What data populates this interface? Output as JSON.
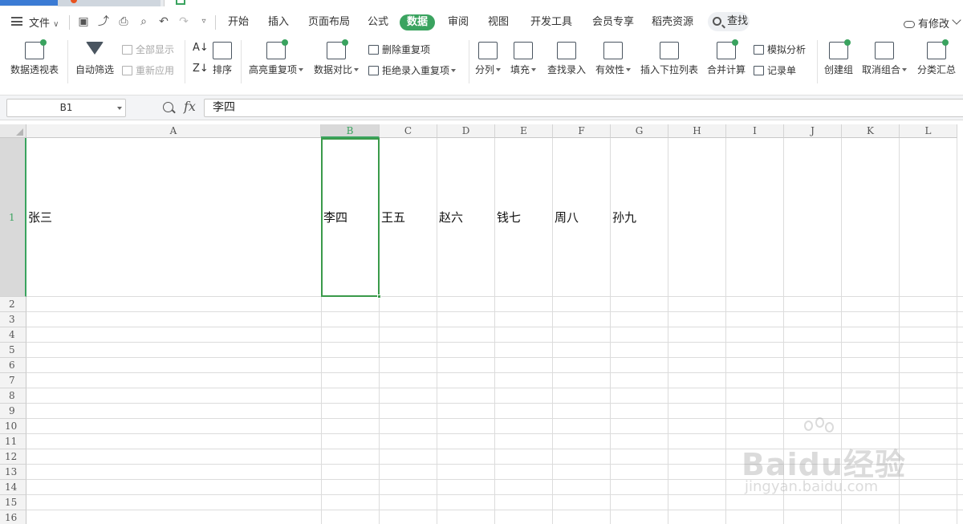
{
  "menu": {
    "file": "文件",
    "tabs": [
      "开始",
      "插入",
      "页面布局",
      "公式",
      "数据",
      "审阅",
      "视图",
      "开发工具",
      "会员专享",
      "稻壳资源"
    ],
    "active_tab": "数据",
    "search": "查找",
    "status": "有修改"
  },
  "ribbon": {
    "pivot": "数据透视表",
    "autofilter": "自动筛选",
    "show_all": "全部显示",
    "reapply": "重新应用",
    "sort": "排序",
    "highlight_dup": "高亮重复项",
    "compare": "数据对比",
    "delete_dup": "删除重复项",
    "reject_dup": "拒绝录入重复项",
    "split": "分列",
    "fill": "填充",
    "lookup_entry": "查找录入",
    "validity": "有效性",
    "insert_dropdown": "插入下拉列表",
    "consolidate": "合并计算",
    "simulate": "模拟分析",
    "record": "记录单",
    "create_group": "创建组",
    "ungroup": "取消组合",
    "subtotal": "分类汇总"
  },
  "formula_bar": {
    "cell_ref": "B1",
    "fx": "fx",
    "content": "李四"
  },
  "grid": {
    "columns": [
      "A",
      "B",
      "C",
      "D",
      "E",
      "F",
      "G",
      "H",
      "I",
      "J",
      "K",
      "L"
    ],
    "rows": [
      "1",
      "2",
      "3",
      "4",
      "5",
      "6",
      "7",
      "8",
      "9",
      "10",
      "11",
      "12",
      "13",
      "14",
      "15",
      "16"
    ],
    "selected_cell": "B1",
    "row1": {
      "A": "张三",
      "B": "李四",
      "C": "王五",
      "D": "赵六",
      "E": "钱七",
      "F": "周八",
      "G": "孙九"
    }
  },
  "watermark": {
    "logo": "Baidu经验",
    "url": "jingyan.baidu.com"
  },
  "colors": {
    "accent": "#3aa35f",
    "selection": "#3a9a4a"
  }
}
